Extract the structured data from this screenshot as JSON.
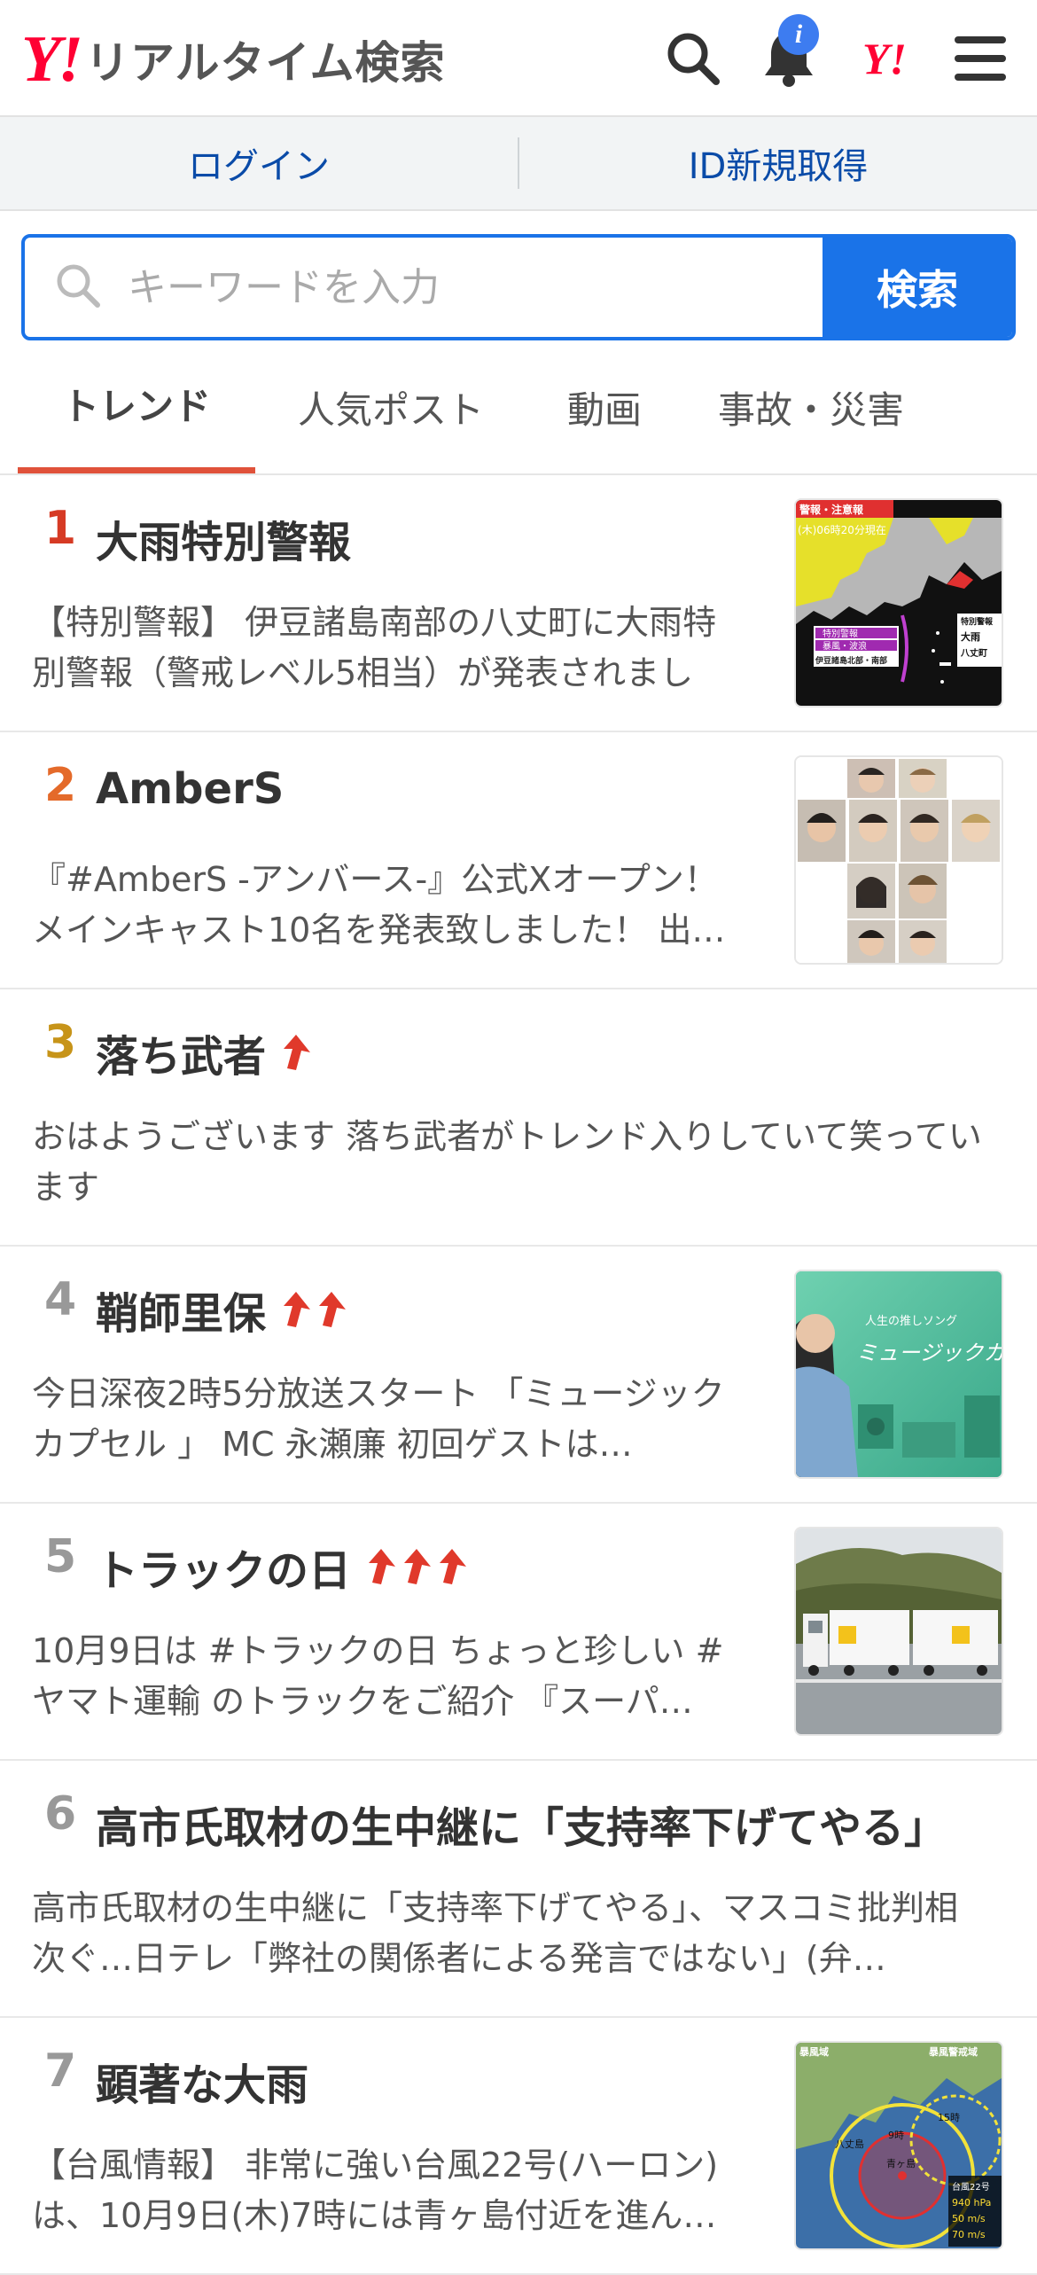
{
  "header": {
    "logo_mark": "Y!",
    "logo_text": "リアルタイム検索",
    "notification_badge": "i",
    "yahoo_mark": "Y!"
  },
  "login_bar": {
    "login": "ログイン",
    "register": "ID新規取得"
  },
  "search": {
    "placeholder": "キーワードを入力",
    "button": "検索"
  },
  "tabs": [
    {
      "label": "トレンド",
      "active": true
    },
    {
      "label": "人気ポスト",
      "active": false
    },
    {
      "label": "動画",
      "active": false
    },
    {
      "label": "事故・災害",
      "active": false
    }
  ],
  "colors": {
    "accent_blue": "#1a73e8",
    "brand_red": "#ff0033",
    "tab_underline": "#e0523a",
    "rank1": "#d63a24",
    "rank2": "#e46a2a",
    "rank3": "#c79419",
    "rank_other": "#999999",
    "up_arrow": "#e0392b"
  },
  "trends": [
    {
      "rank": "1",
      "title": "大雨特別警報",
      "arrows": 0,
      "desc": "【特別警報】 伊豆諸島南部の八丈町に大雨特別警報（警戒レベル5相当）が発表されました…",
      "thumb": "weather-map"
    },
    {
      "rank": "2",
      "title": "AmberS",
      "arrows": 0,
      "desc": "『#AmberS -アンバース-』公式Xオープン！ メインキャスト10名を発表致しました！ 出…",
      "thumb": "cast-grid"
    },
    {
      "rank": "3",
      "title": "落ち武者",
      "arrows": 1,
      "desc": "おはようございます 落ち武者がトレンド入りしていて笑っています",
      "thumb": null
    },
    {
      "rank": "4",
      "title": "鞘師里保",
      "arrows": 2,
      "desc": "今日深夜2時5分放送スタート 「ミュージックカプセル 」 MC 永瀬廉 初回ゲストは…",
      "thumb": "music-capsule"
    },
    {
      "rank": "5",
      "title": "トラックの日",
      "arrows": 3,
      "desc": "10月9日は #トラックの日 ちょっと珍しい #ヤマト運輸 のトラックをご紹介 『スーパ…",
      "thumb": "truck"
    },
    {
      "rank": "6",
      "title": "高市氏取材の生中継に「支持率下げてやる」",
      "arrows": 0,
      "desc": "高市氏取材の生中継に「支持率下げてやる」、マスコミ批判相次ぐ…日テレ「弊社の関係者による発言ではない」(弁…",
      "thumb": null
    },
    {
      "rank": "7",
      "title": "顕著な大雨",
      "arrows": 0,
      "desc": "【台風情報】 非常に強い台風22号(ハーロン)は、10月9日(木)7時には青ヶ島付近を進ん…",
      "thumb": "typhoon-map"
    }
  ],
  "thumb_text": {
    "weather_header": "警報・注意報",
    "weather_time": "(木)06時20分現在",
    "weather_box1": "特別警報",
    "weather_box2": "暴風・波浪",
    "weather_box3": "伊豆諸島北部・南部",
    "weather_callout1": "特別警報",
    "weather_callout2": "大雨",
    "weather_callout3": "八丈町",
    "music_sub": "人生の推しソング",
    "music_title": "ミュージックカプセ",
    "typhoon_label": "台風22号",
    "typhoon_pressure": "940 hPa",
    "typhoon_wind1": "50 m/s",
    "typhoon_wind2": "70 m/s",
    "typhoon_area1": "暴風域",
    "typhoon_area2": "暴風警戒域",
    "typhoon_place": "八丈島",
    "typhoon_place2": "青ヶ島",
    "typhoon_time1": "9時",
    "typhoon_time2": "15時"
  }
}
